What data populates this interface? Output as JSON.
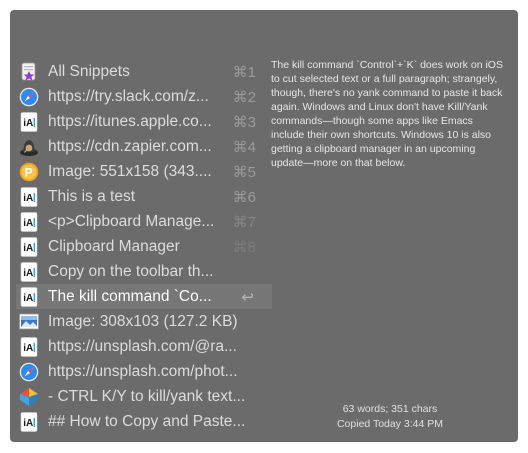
{
  "items": [
    {
      "label": "All Snippets",
      "shortcut": "⌘1",
      "icon": "snippets-icon"
    },
    {
      "label": "https://try.slack.com/z...",
      "shortcut": "⌘2",
      "icon": "safari-icon"
    },
    {
      "label": "https://itunes.apple.co...",
      "shortcut": "⌘3",
      "icon": "ia-writer-icon"
    },
    {
      "label": "https://cdn.zapier.com...",
      "shortcut": "⌘4",
      "icon": "alfred-icon"
    },
    {
      "label": "Image: 551x158 (343....",
      "shortcut": "⌘5",
      "icon": "pixelmator-icon"
    },
    {
      "label": "This is a test",
      "shortcut": "⌘6",
      "icon": "ia-writer-icon"
    },
    {
      "label": "<p>Clipboard Manage...",
      "shortcut": "⌘7",
      "icon": "ia-writer-icon"
    },
    {
      "label": "Clipboard Manager",
      "shortcut": "⌘8",
      "icon": "ia-writer-icon"
    },
    {
      "label": "Copy on the toolbar th...",
      "shortcut": "",
      "icon": "ia-writer-icon"
    },
    {
      "label": "The kill command `Co...",
      "shortcut": "↩",
      "icon": "ia-writer-icon",
      "selected": true
    },
    {
      "label": "Image: 308x103 (127.2 KB)",
      "shortcut": "",
      "icon": "image-icon"
    },
    {
      "label": "https://unsplash.com/@ra...",
      "shortcut": "",
      "icon": "ia-writer-icon"
    },
    {
      "label": "https://unsplash.com/phot...",
      "shortcut": "",
      "icon": "safari-icon"
    },
    {
      "label": "- CTRL K/Y to kill/yank text...",
      "shortcut": "",
      "icon": "airmail-icon"
    },
    {
      "label": "## How to Copy and Paste...",
      "shortcut": "",
      "icon": "ia-writer-icon"
    }
  ],
  "preview": {
    "text": "The kill command `Control`+`K` does work on iOS to cut selected text or a full paragraph; strangely, though, there's no yank command to paste it back again. Windows and Linux don't have Kill/Yank commands—though some apps like Emacs include their own shortcuts. Windows 10 is also getting a clipboard manager in an upcoming update—more on that below."
  },
  "meta": {
    "counts": "63 words; 351 chars",
    "copied": "Copied Today 3:44 PM"
  }
}
